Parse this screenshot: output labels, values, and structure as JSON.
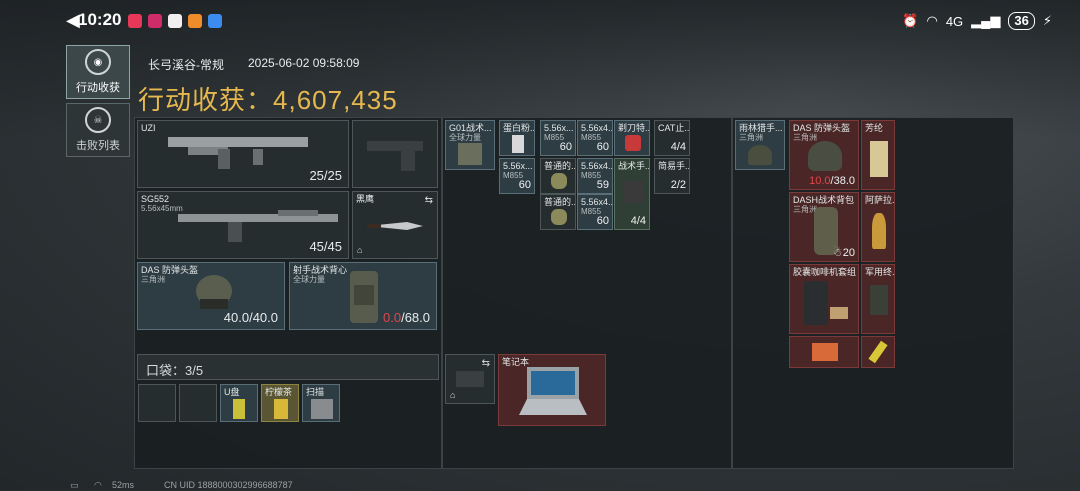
{
  "status_bar": {
    "time": "10:20",
    "battery": "36",
    "network": "4G"
  },
  "nav": {
    "loot_tab": "行动收获",
    "kill_tab": "击败列表"
  },
  "header": {
    "map": "长弓溪谷-常规",
    "datetime": "2025-06-02 09:58:09",
    "total_label": "行动收获：",
    "total_value": "4,607,435"
  },
  "equip": {
    "primary": {
      "name": "UZI",
      "ammo": "25/25"
    },
    "secondary": {
      "name": "SG552",
      "caliber": "5.56x45mm",
      "ammo": "45/45"
    },
    "melee": {
      "name": "黑鹰"
    },
    "helmet": {
      "name": "DAS 防弹头盔",
      "sub": "三角洲",
      "dura_cur": "40.0",
      "dura_max": "/40.0"
    },
    "vest": {
      "name": "射手战术背心",
      "sub": "全球力量",
      "dura_cur": "0.0",
      "dura_max": "/68.0"
    }
  },
  "pocket": {
    "label": "口袋：3/5",
    "items": [
      "U盘",
      "柠檬茶",
      "扫描"
    ]
  },
  "loot_items": [
    {
      "name": "G01战术...",
      "sub": "全球力量"
    },
    {
      "name": "蛋白粉..."
    },
    {
      "name": "5.56x...",
      "sub": "M855",
      "count": "60"
    },
    {
      "name": "5.56x4...",
      "sub": "M855",
      "count": "60"
    },
    {
      "name": "剃刀特..."
    },
    {
      "name": "CAT止...",
      "count": "4/4"
    },
    {
      "name": "5.56x...",
      "sub": "M855",
      "count": "60"
    },
    {
      "name": "普通的..."
    },
    {
      "name": "5.56x4...",
      "sub": "M855",
      "count": "59"
    },
    {
      "name": "战术手...",
      "count": "4/4"
    },
    {
      "name": "简易手...",
      "count": "2/2"
    },
    {
      "name": "普通的..."
    },
    {
      "name": "5.56x4...",
      "sub": "M855",
      "count": "60"
    },
    {
      "name": "笔记本"
    }
  ],
  "backpack": {
    "left": {
      "name": "雨林猎手...",
      "sub": "三角洲"
    },
    "helmet": {
      "name": "DAS 防弹头盔",
      "sub": "三角洲",
      "dura_cur": "10.0",
      "dura_max": "/38.0"
    },
    "item2": {
      "name": "芳纶"
    },
    "bag": {
      "name": "DASH战术背包",
      "sub": "三角洲",
      "count": "20"
    },
    "item4": {
      "name": "阿萨拉..."
    },
    "coffee": {
      "name": "胶囊咖啡机套组"
    },
    "item6": {
      "name": "军用终..."
    }
  },
  "footer": {
    "ping": "52ms",
    "uid": "CN UID 1888000302996688787"
  }
}
